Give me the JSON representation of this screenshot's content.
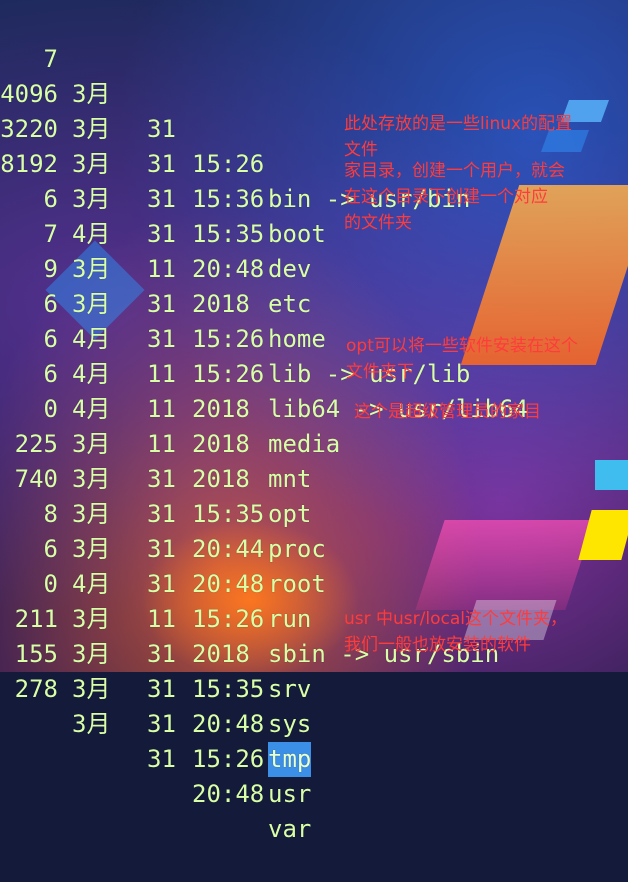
{
  "listing": [
    {
      "size": "7",
      "month": "3月",
      "day": "31",
      "time": "15:26",
      "name": "bin -> usr/bin"
    },
    {
      "size": "4096",
      "month": "3月",
      "day": "31",
      "time": "15:36",
      "name": "boot"
    },
    {
      "size": "3220",
      "month": "3月",
      "day": "31",
      "time": "15:35",
      "name": "dev"
    },
    {
      "size": "8192",
      "month": "3月",
      "day": "31",
      "time": "20:48",
      "name": "etc"
    },
    {
      "size": "6",
      "month": "4月",
      "day": "11",
      "time": "2018",
      "name": "home"
    },
    {
      "size": "7",
      "month": "3月",
      "day": "31",
      "time": "15:26",
      "name": "lib -> usr/lib"
    },
    {
      "size": "9",
      "month": "3月",
      "day": "31",
      "time": "15:26",
      "name": "lib64 -> usr/lib64"
    },
    {
      "size": "6",
      "month": "4月",
      "day": "11",
      "time": "2018",
      "name": "media"
    },
    {
      "size": "6",
      "month": "4月",
      "day": "11",
      "time": "2018",
      "name": "mnt"
    },
    {
      "size": "6",
      "month": "4月",
      "day": "11",
      "time": "2018",
      "name": "opt"
    },
    {
      "size": "0",
      "month": "3月",
      "day": "31",
      "time": "15:35",
      "name": "proc"
    },
    {
      "size": "225",
      "month": "3月",
      "day": "31",
      "time": "20:44",
      "name": "root"
    },
    {
      "size": "740",
      "month": "3月",
      "day": "31",
      "time": "20:48",
      "name": "run"
    },
    {
      "size": "8",
      "month": "3月",
      "day": "31",
      "time": "15:26",
      "name": "sbin -> usr/sbin"
    },
    {
      "size": "6",
      "month": "4月",
      "day": "11",
      "time": "2018",
      "name": "srv"
    },
    {
      "size": "0",
      "month": "3月",
      "day": "31",
      "time": "15:35",
      "name": "sys"
    },
    {
      "size": "211",
      "month": "3月",
      "day": "31",
      "time": "20:48",
      "name": "tmp"
    },
    {
      "size": "155",
      "month": "3月",
      "day": "31",
      "time": "15:26",
      "name": "usr"
    },
    {
      "size": "278",
      "month": "3月",
      "day": "31",
      "time": "20:48",
      "name": "var"
    }
  ],
  "annotations": {
    "etc": "此处存放的是一些linux的配置\n文件",
    "home": "家目录，创建一个用户，就会\n在这个目录下创建一个对应\n的文件夹",
    "opt": "opt可以将一些软件安装在这个\n文件夹下",
    "root": "这个是超级管理员的家目",
    "usr": "usr 中usr/local这个文件夹，\n我们一般也放安装的软件"
  },
  "colors": {
    "terminal_text": "#d8ffa8",
    "annotation_text": "#ff3b3b",
    "selection_highlight": "#3b8fe6"
  }
}
